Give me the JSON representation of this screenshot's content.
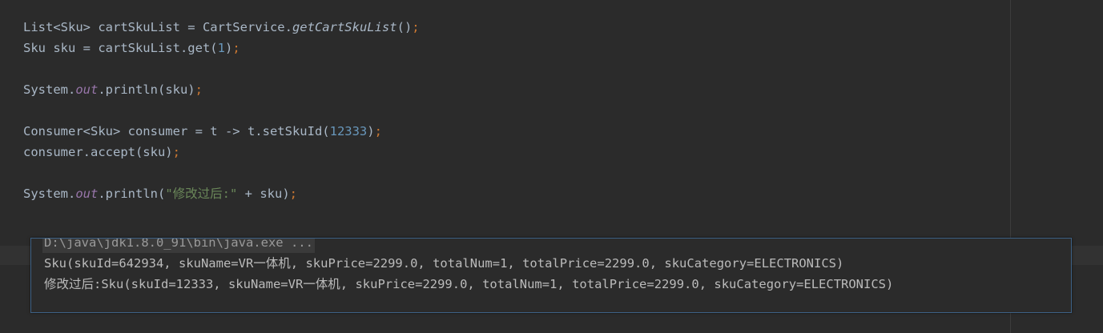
{
  "code": {
    "line1": {
      "a": "List<Sku> cartSkuList = CartService.",
      "method": "getCartSkuList",
      "b": "()",
      "semi": ";"
    },
    "line2": {
      "a": "Sku sku = cartSkuList.get(",
      "num": "1",
      "b": ")",
      "semi": ";"
    },
    "line3": {
      "a": "System.",
      "field": "out",
      "b": ".println(sku)",
      "semi": ";"
    },
    "line4": {
      "a": "Consumer<Sku> consumer = t -> t.setSkuId(",
      "num": "12333",
      "b": ")",
      "semi": ";"
    },
    "line5": {
      "a": "consumer.accept(sku)",
      "semi": ";"
    },
    "line6": {
      "a": "System.",
      "field": "out",
      "b": ".println(",
      "str": "\"修改过后:\"",
      "c": " + sku)",
      "semi": ";"
    }
  },
  "console": {
    "command": "D:\\java\\jdk1.8.0_91\\bin\\java.exe ...",
    "output1": "Sku(skuId=642934, skuName=VR一体机, skuPrice=2299.0, totalNum=1, totalPrice=2299.0, skuCategory=ELECTRONICS)",
    "output2": "修改过后:Sku(skuId=12333, skuName=VR一体机, skuPrice=2299.0, totalNum=1, totalPrice=2299.0, skuCategory=ELECTRONICS)"
  },
  "colors": {
    "background": "#2b2b2b",
    "text": "#a9b7c6",
    "keyword": "#cc7832",
    "number": "#6897bb",
    "string": "#6a8759",
    "field": "#9876aa",
    "console_border": "#3d6185"
  }
}
